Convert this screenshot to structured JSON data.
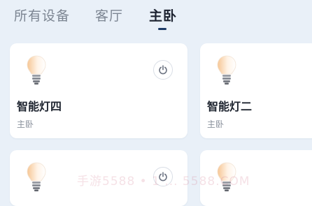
{
  "tabs": [
    {
      "label": "所有设备",
      "active": false
    },
    {
      "label": "客厅",
      "active": false
    },
    {
      "label": "主卧",
      "active": true
    }
  ],
  "devices": [
    {
      "name": "智能灯四",
      "room": "主卧",
      "icon": "light-bulb-icon",
      "power_icon": "power-icon"
    },
    {
      "name": "智能灯二",
      "room": "主卧",
      "icon": "light-bulb-icon"
    },
    {
      "name": "",
      "room": "",
      "icon": "light-bulb-icon",
      "power_icon": "power-icon"
    },
    {
      "name": "",
      "room": "",
      "icon": "light-bulb-icon"
    }
  ],
  "watermark": "手游5588 • 1 ... 5588.COM",
  "colors": {
    "background": "#e9f0f8",
    "card": "#ffffff",
    "active_tab": "#1c2230",
    "tab_indicator": "#1c3a66",
    "inactive_tab": "#7c8592"
  }
}
